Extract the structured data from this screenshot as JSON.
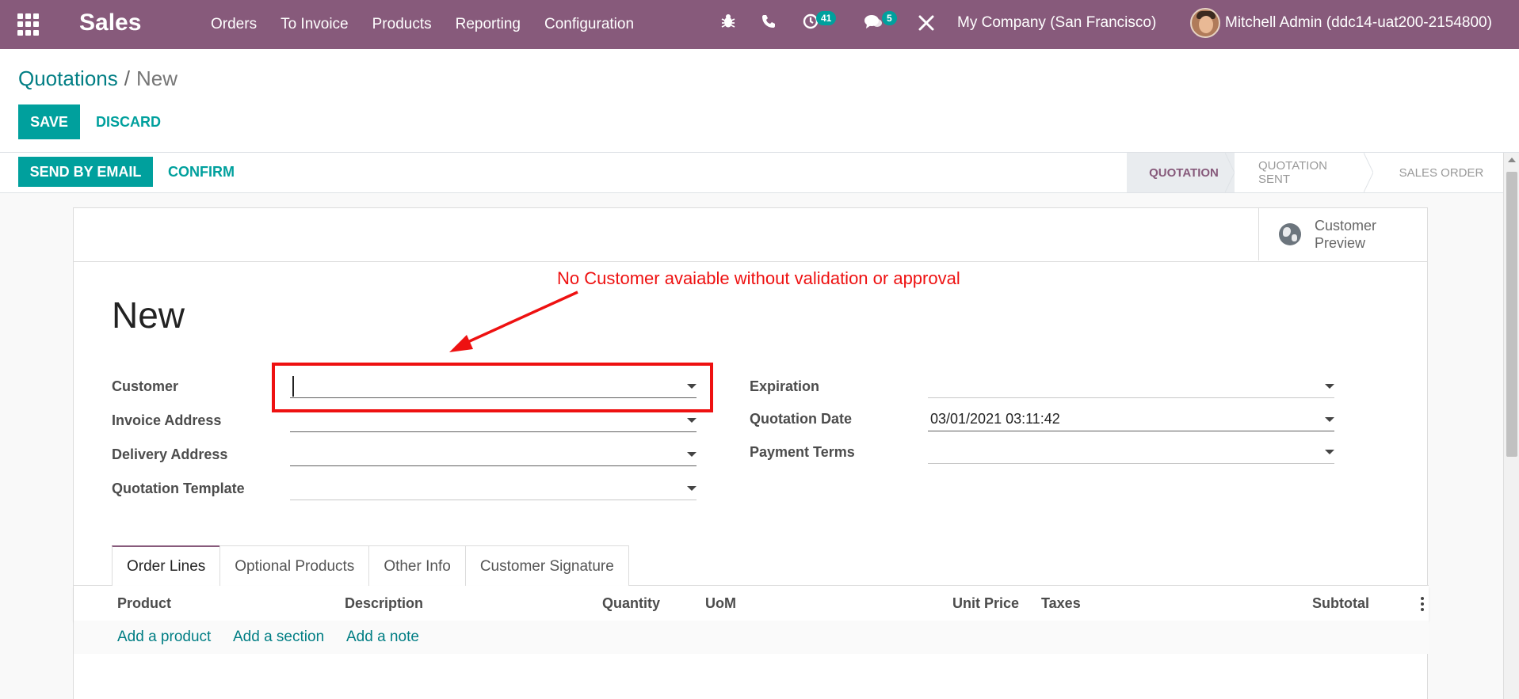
{
  "navbar": {
    "app_name": "Sales",
    "menu": [
      "Orders",
      "To Invoice",
      "Products",
      "Reporting",
      "Configuration"
    ],
    "activity_count": "41",
    "message_count": "5",
    "company": "My Company (San Francisco)",
    "user": "Mitchell Admin (ddc14-uat200-2154800)",
    "color": "#875a7b"
  },
  "breadcrumb": {
    "parent": "Quotations",
    "separator": "/",
    "current": "New"
  },
  "buttons": {
    "save": "SAVE",
    "discard": "DISCARD",
    "send_email": "SEND BY EMAIL",
    "confirm": "CONFIRM"
  },
  "stages": [
    {
      "label": "QUOTATION",
      "active": true
    },
    {
      "label": "QUOTATION SENT",
      "active": false
    },
    {
      "label": "SALES ORDER",
      "active": false
    }
  ],
  "sheet": {
    "customer_preview": "Customer Preview",
    "title": "New",
    "annotation": "No Customer avaiable without validation or approval"
  },
  "fields": {
    "customer": {
      "label": "Customer",
      "value": ""
    },
    "invoice_address": {
      "label": "Invoice Address",
      "value": ""
    },
    "delivery_address": {
      "label": "Delivery Address",
      "value": ""
    },
    "quotation_template": {
      "label": "Quotation Template",
      "value": ""
    },
    "expiration": {
      "label": "Expiration",
      "value": ""
    },
    "quotation_date": {
      "label": "Quotation Date",
      "value": "03/01/2021 03:11:42"
    },
    "payment_terms": {
      "label": "Payment Terms",
      "value": ""
    }
  },
  "tabs": [
    "Order Lines",
    "Optional Products",
    "Other Info",
    "Customer Signature"
  ],
  "order_lines": {
    "columns": [
      "Product",
      "Description",
      "Quantity",
      "UoM",
      "Unit Price",
      "Taxes",
      "Subtotal"
    ],
    "add_product": "Add a product",
    "add_section": "Add a section",
    "add_note": "Add a note"
  },
  "colors": {
    "accent": "#00a09d",
    "annotation": "#ee1111"
  }
}
